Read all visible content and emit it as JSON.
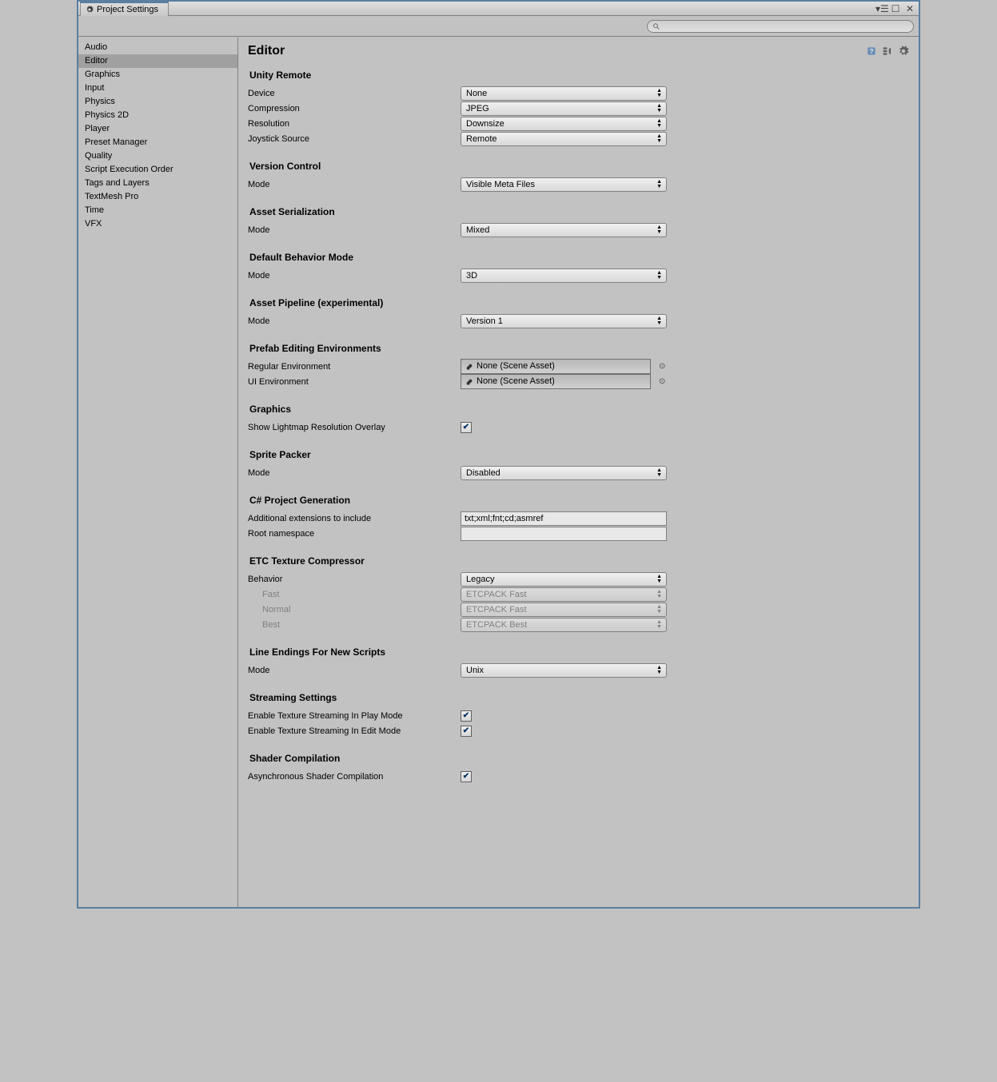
{
  "window": {
    "title": "Project Settings"
  },
  "sidebar": {
    "items": [
      "Audio",
      "Editor",
      "Graphics",
      "Input",
      "Physics",
      "Physics 2D",
      "Player",
      "Preset Manager",
      "Quality",
      "Script Execution Order",
      "Tags and Layers",
      "TextMesh Pro",
      "Time",
      "VFX"
    ],
    "selected_index": 1
  },
  "page": {
    "title": "Editor"
  },
  "search": {
    "placeholder": ""
  },
  "sections": [
    {
      "title": "Unity Remote",
      "rows": [
        {
          "label": "Device",
          "type": "dropdown",
          "value": "None"
        },
        {
          "label": "Compression",
          "type": "dropdown",
          "value": "JPEG"
        },
        {
          "label": "Resolution",
          "type": "dropdown",
          "value": "Downsize"
        },
        {
          "label": "Joystick Source",
          "type": "dropdown",
          "value": "Remote"
        }
      ]
    },
    {
      "title": "Version Control",
      "rows": [
        {
          "label": "Mode",
          "type": "dropdown",
          "value": "Visible Meta Files"
        }
      ]
    },
    {
      "title": "Asset Serialization",
      "rows": [
        {
          "label": "Mode",
          "type": "dropdown",
          "value": "Mixed"
        }
      ]
    },
    {
      "title": "Default Behavior Mode",
      "rows": [
        {
          "label": "Mode",
          "type": "dropdown",
          "value": "3D"
        }
      ]
    },
    {
      "title": "Asset Pipeline (experimental)",
      "rows": [
        {
          "label": "Mode",
          "type": "dropdown",
          "value": "Version 1"
        }
      ]
    },
    {
      "title": "Prefab Editing Environments",
      "rows": [
        {
          "label": "Regular Environment",
          "type": "obj",
          "value": "None (Scene Asset)"
        },
        {
          "label": "UI Environment",
          "type": "obj",
          "value": "None (Scene Asset)"
        }
      ]
    },
    {
      "title": "Graphics",
      "rows": [
        {
          "label": "Show Lightmap Resolution Overlay",
          "type": "check",
          "value": true
        }
      ]
    },
    {
      "title": "Sprite Packer",
      "rows": [
        {
          "label": "Mode",
          "type": "dropdown",
          "value": "Disabled"
        }
      ]
    },
    {
      "title": "C# Project Generation",
      "rows": [
        {
          "label": "Additional extensions to include",
          "type": "text",
          "value": "txt;xml;fnt;cd;asmref"
        },
        {
          "label": "Root namespace",
          "type": "text",
          "value": ""
        }
      ]
    },
    {
      "title": "ETC Texture Compressor",
      "rows": [
        {
          "label": "Behavior",
          "type": "dropdown",
          "value": "Legacy"
        },
        {
          "label": "Fast",
          "type": "dropdown",
          "value": "ETCPACK Fast",
          "indent": true,
          "disabled": true
        },
        {
          "label": "Normal",
          "type": "dropdown",
          "value": "ETCPACK Fast",
          "indent": true,
          "disabled": true
        },
        {
          "label": "Best",
          "type": "dropdown",
          "value": "ETCPACK Best",
          "indent": true,
          "disabled": true
        }
      ]
    },
    {
      "title": "Line Endings For New Scripts",
      "rows": [
        {
          "label": "Mode",
          "type": "dropdown",
          "value": "Unix"
        }
      ]
    },
    {
      "title": "Streaming Settings",
      "rows": [
        {
          "label": "Enable Texture Streaming In Play Mode",
          "type": "check",
          "value": true
        },
        {
          "label": "Enable Texture Streaming In Edit Mode",
          "type": "check",
          "value": true
        }
      ]
    },
    {
      "title": "Shader Compilation",
      "rows": [
        {
          "label": "Asynchronous Shader Compilation",
          "type": "check",
          "value": true
        }
      ]
    }
  ]
}
